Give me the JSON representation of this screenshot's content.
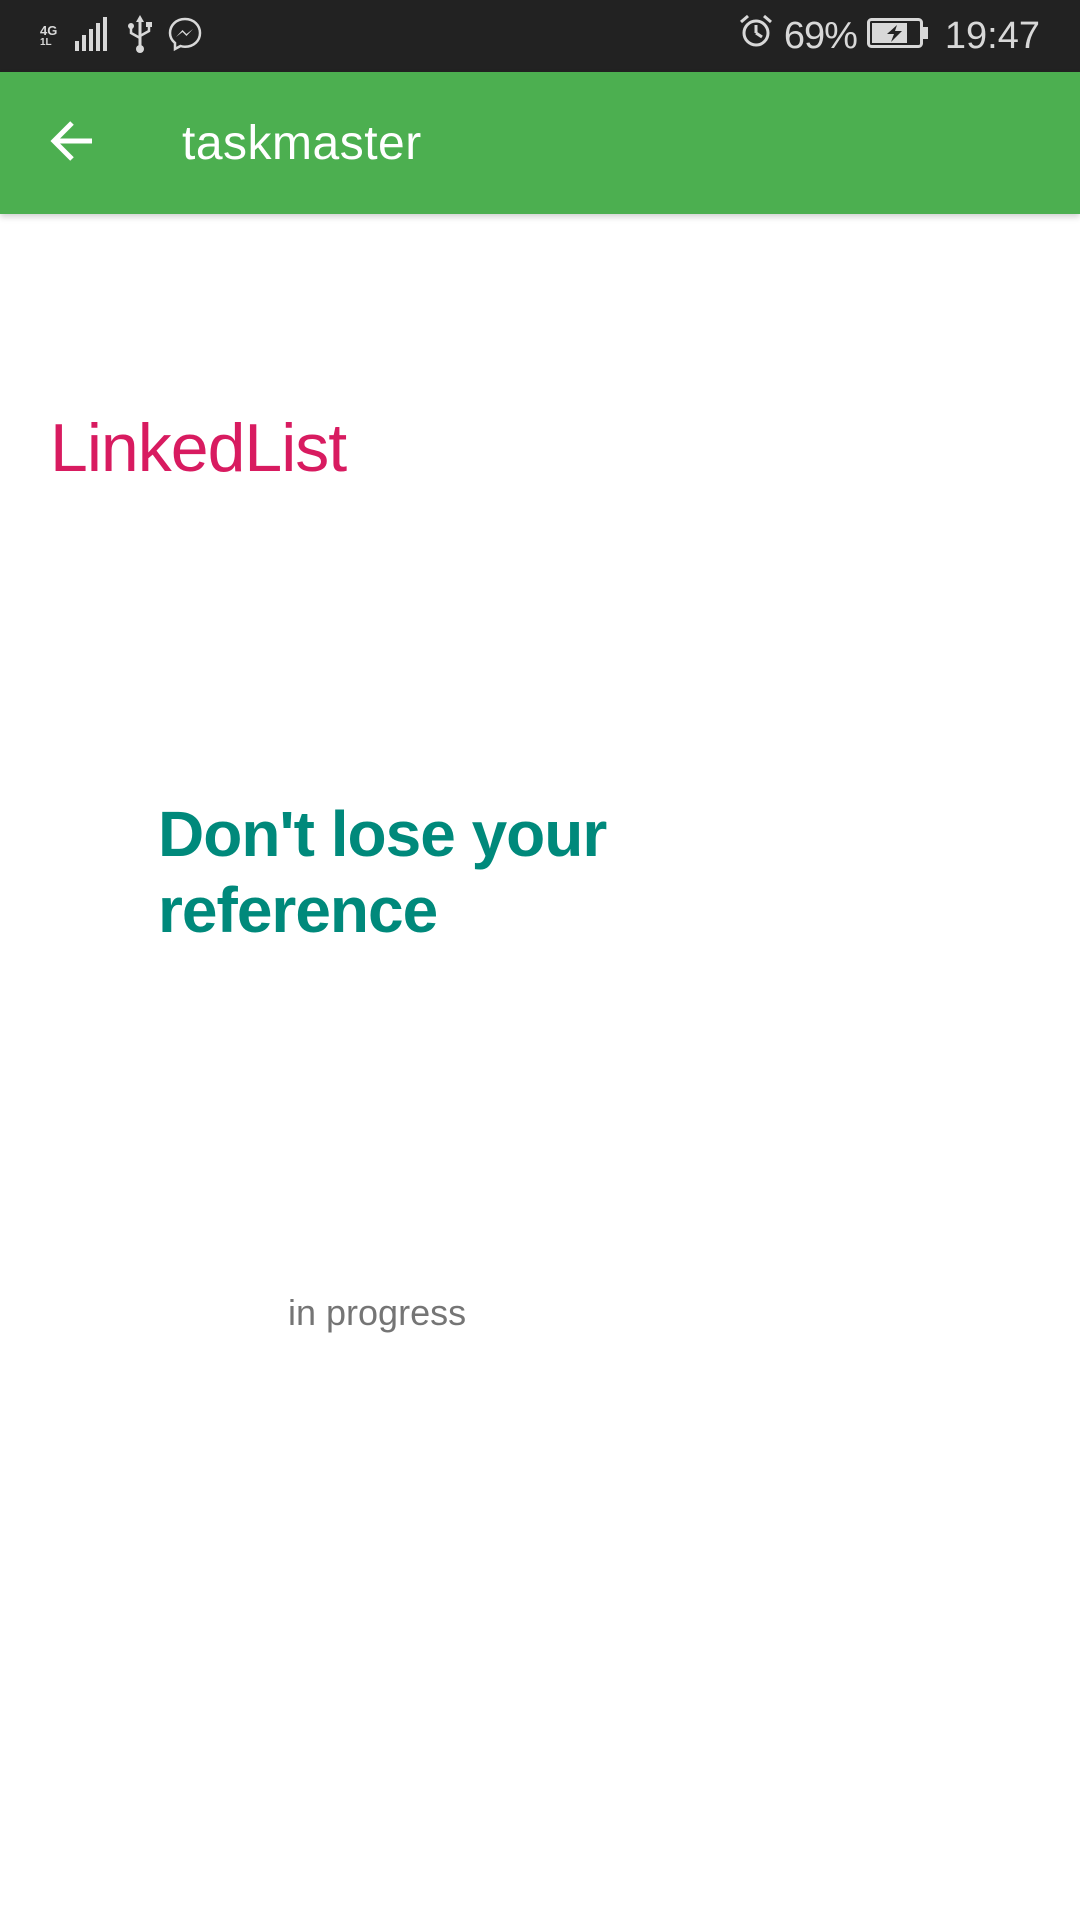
{
  "status_bar": {
    "network_type": "4G",
    "network_sub": "1L",
    "icons": [
      "signal-icon",
      "usb-icon",
      "messenger-icon",
      "alarm-icon",
      "battery-charging-icon"
    ],
    "battery_percent": "69%",
    "time": "19:47",
    "background": "#222222"
  },
  "app_bar": {
    "back_icon": "arrow-back-icon",
    "title": "taskmaster",
    "background": "#4caf50"
  },
  "content": {
    "topic_title": "LinkedList",
    "topic_color": "#d81b60",
    "task_name": "Don't lose your reference",
    "task_color": "#00897b",
    "task_status": "in progress"
  }
}
